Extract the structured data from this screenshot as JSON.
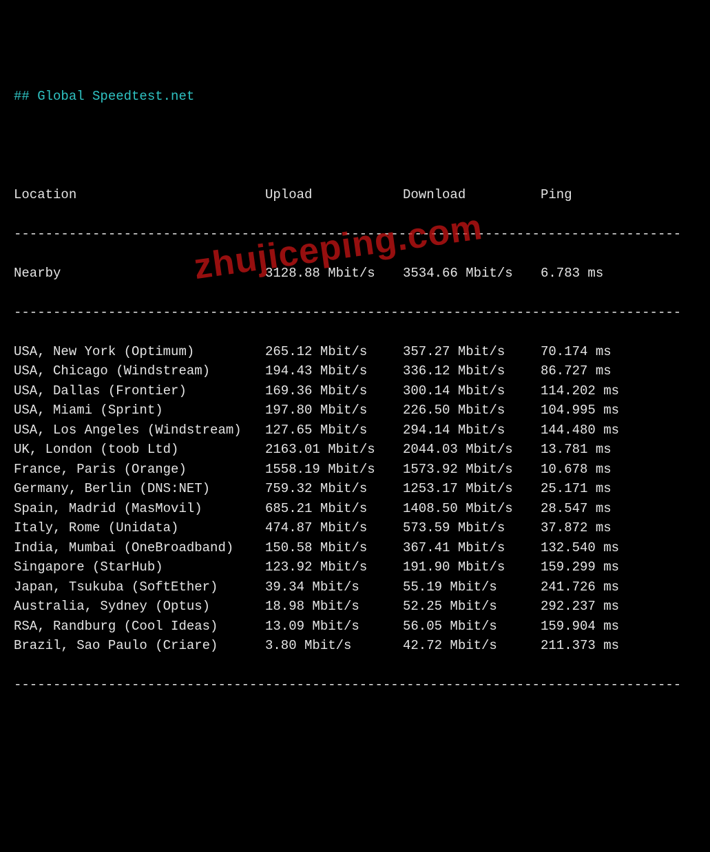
{
  "title": "## Global Speedtest.net",
  "headers": {
    "location": "Location",
    "upload": "Upload",
    "download": "Download",
    "ping": "Ping"
  },
  "separator": "-------------------------------------------------------------------------------------",
  "nearby": {
    "location": "Nearby",
    "upload": "3128.88 Mbit/s",
    "download": "3534.66 Mbit/s",
    "ping": "6.783 ms"
  },
  "rows": [
    {
      "location": "USA, New York (Optimum)",
      "upload": "265.12 Mbit/s",
      "download": "357.27 Mbit/s",
      "ping": "70.174 ms"
    },
    {
      "location": "USA, Chicago (Windstream)",
      "upload": "194.43 Mbit/s",
      "download": "336.12 Mbit/s",
      "ping": "86.727 ms"
    },
    {
      "location": "USA, Dallas (Frontier)",
      "upload": "169.36 Mbit/s",
      "download": "300.14 Mbit/s",
      "ping": "114.202 ms"
    },
    {
      "location": "USA, Miami (Sprint)",
      "upload": "197.80 Mbit/s",
      "download": "226.50 Mbit/s",
      "ping": "104.995 ms"
    },
    {
      "location": "USA, Los Angeles (Windstream)",
      "upload": "127.65 Mbit/s",
      "download": "294.14 Mbit/s",
      "ping": "144.480 ms"
    },
    {
      "location": "UK, London (toob Ltd)",
      "upload": "2163.01 Mbit/s",
      "download": "2044.03 Mbit/s",
      "ping": "13.781 ms"
    },
    {
      "location": "France, Paris (Orange)",
      "upload": "1558.19 Mbit/s",
      "download": "1573.92 Mbit/s",
      "ping": "10.678 ms"
    },
    {
      "location": "Germany, Berlin (DNS:NET)",
      "upload": "759.32 Mbit/s",
      "download": "1253.17 Mbit/s",
      "ping": "25.171 ms"
    },
    {
      "location": "Spain, Madrid (MasMovil)",
      "upload": "685.21 Mbit/s",
      "download": "1408.50 Mbit/s",
      "ping": "28.547 ms"
    },
    {
      "location": "Italy, Rome (Unidata)",
      "upload": "474.87 Mbit/s",
      "download": "573.59 Mbit/s",
      "ping": "37.872 ms"
    },
    {
      "location": "India, Mumbai (OneBroadband)",
      "upload": "150.58 Mbit/s",
      "download": "367.41 Mbit/s",
      "ping": "132.540 ms"
    },
    {
      "location": "Singapore (StarHub)",
      "upload": "123.92 Mbit/s",
      "download": "191.90 Mbit/s",
      "ping": "159.299 ms"
    },
    {
      "location": "Japan, Tsukuba (SoftEther)",
      "upload": "39.34 Mbit/s",
      "download": "55.19 Mbit/s",
      "ping": "241.726 ms"
    },
    {
      "location": "Australia, Sydney (Optus)",
      "upload": "18.98 Mbit/s",
      "download": "52.25 Mbit/s",
      "ping": "292.237 ms"
    },
    {
      "location": "RSA, Randburg (Cool Ideas)",
      "upload": "13.09 Mbit/s",
      "download": "56.05 Mbit/s",
      "ping": "159.904 ms"
    },
    {
      "location": "Brazil, Sao Paulo (Criare)",
      "upload": "3.80 Mbit/s",
      "download": "42.72 Mbit/s",
      "ping": "211.373 ms"
    }
  ],
  "watermark": "zhujiceping.com"
}
